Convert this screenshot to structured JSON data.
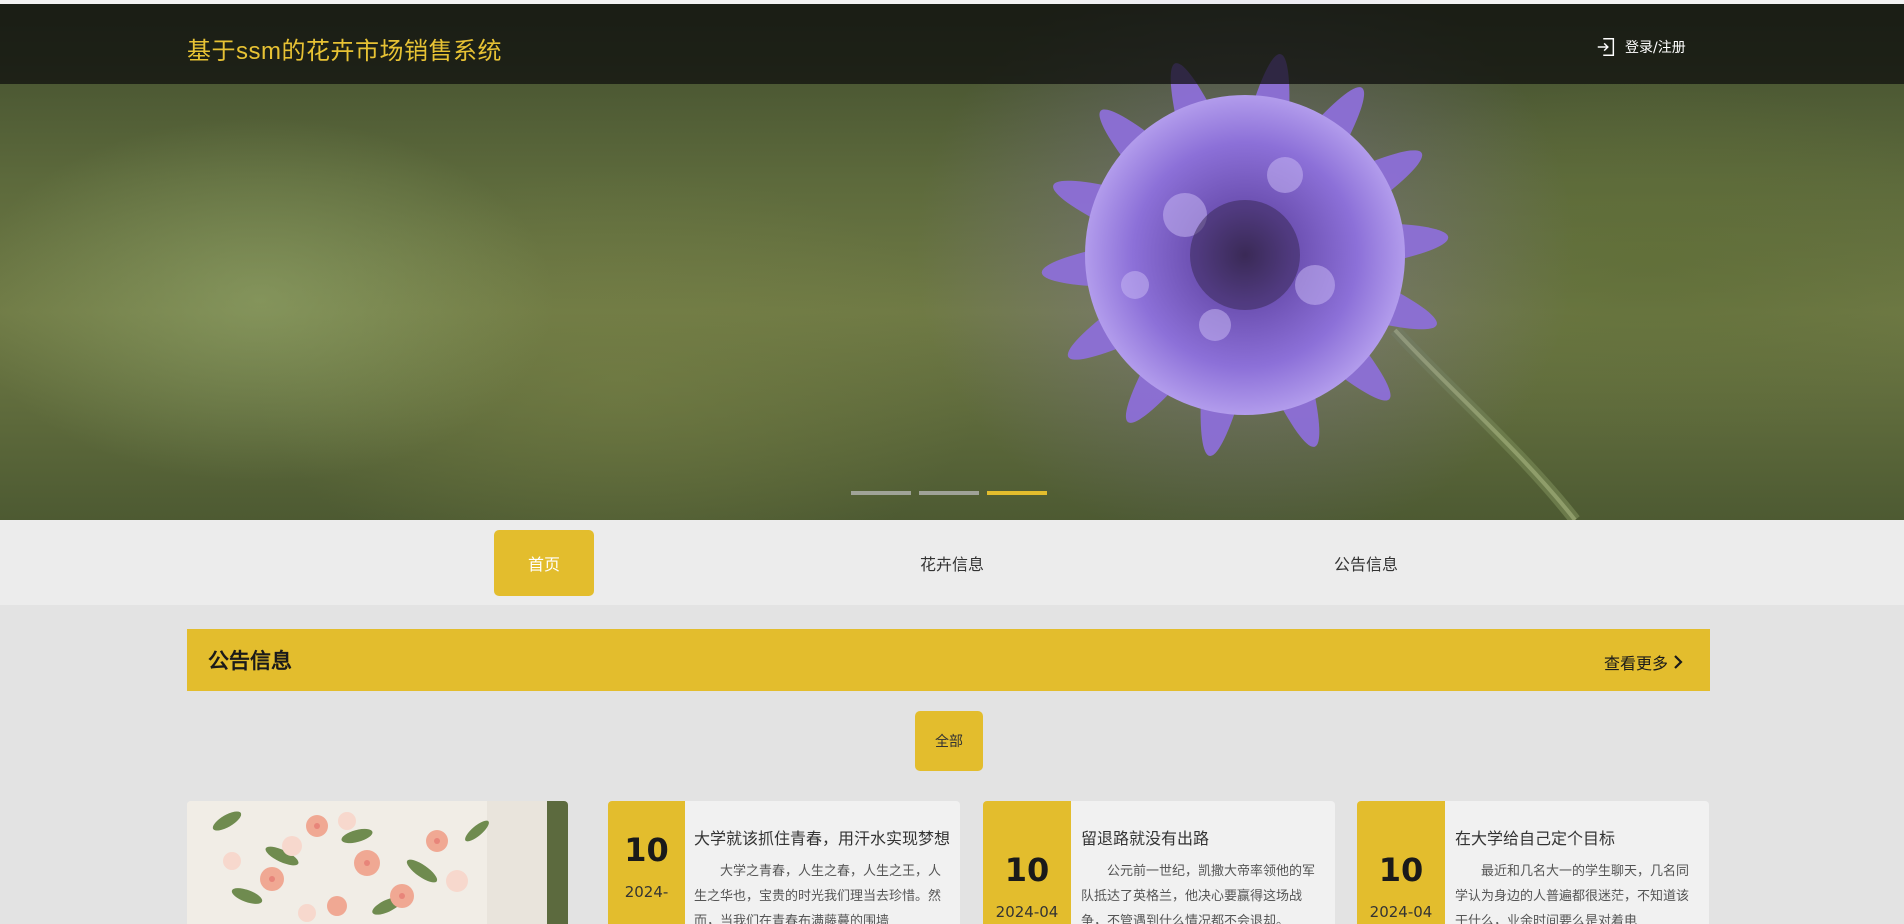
{
  "header": {
    "site_title": "基于ssm的花卉市场销售系统",
    "login_label": "登录/注册"
  },
  "carousel": {
    "slide_count": 3,
    "active_index": 2
  },
  "nav": {
    "items": [
      {
        "label": "首页",
        "active": true
      },
      {
        "label": "花卉信息",
        "active": false
      },
      {
        "label": "公告信息",
        "active": false
      }
    ]
  },
  "notice_section": {
    "title": "公告信息",
    "more_label": "查看更多",
    "filter_label": "全部",
    "cards": [
      {
        "day": "10",
        "year_month": "2024-",
        "title": "大学就该抓住青春，用汗水实现梦想",
        "excerpt": "大学之青春，人生之春，人生之王，人生之华也，宝贵的时光我们理当去珍惜。然而，当我们在青春布满藤蔓的围墙"
      },
      {
        "day": "10",
        "year_month": "2024-04",
        "title": "留退路就没有出路",
        "excerpt": "公元前一世纪，凯撒大帝率领他的军队抵达了英格兰，他决心要赢得这场战争，不管遇到什么情况都不会退却。"
      },
      {
        "day": "10",
        "year_month": "2024-04",
        "title": "在大学给自己定个目标",
        "excerpt": "最近和几名大一的学生聊天，几名同学认为身边的人普遍都很迷茫，不知道该干什么，业余时间要么是对着电"
      }
    ]
  },
  "colors": {
    "accent": "#e3bd2d",
    "title_gold": "#e7c234",
    "header_overlay": "#0c0c0c",
    "nav_bg": "#ececec",
    "page_bg": "#e3e3e3"
  }
}
